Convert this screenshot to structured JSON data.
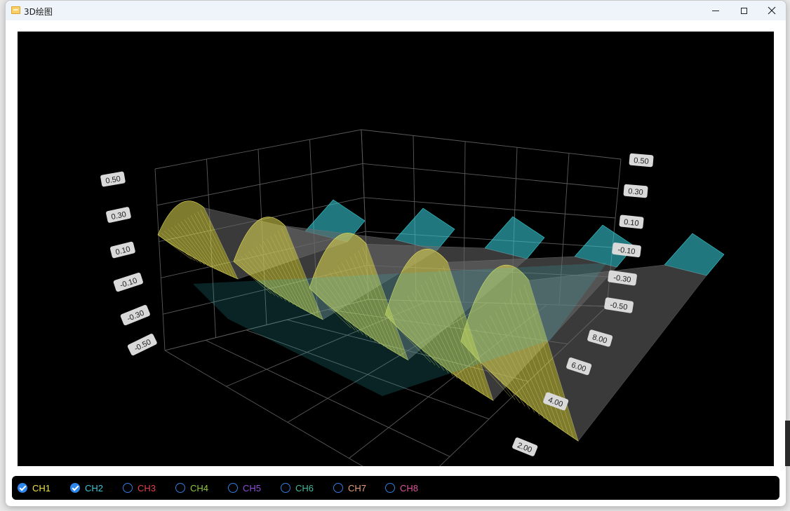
{
  "window": {
    "title": "3D绘图",
    "minimize_icon": "minimize-icon",
    "maximize_icon": "maximize-icon",
    "close_icon": "close-icon"
  },
  "chart_data": {
    "type": "surface-3d",
    "z_ticks": [
      "0.50",
      "0.30",
      "0.10",
      "-0.10",
      "-0.30",
      "-0.50"
    ],
    "depth_ticks": [
      "2.00",
      "4.00",
      "6.00",
      "8.00"
    ],
    "zlim": [
      -0.5,
      0.5
    ],
    "grid": true,
    "background": "#000000",
    "series": [
      {
        "name": "CH1",
        "color": "#e6e055",
        "visible": true
      },
      {
        "name": "CH2",
        "color": "#35c8d2",
        "visible": true
      }
    ]
  },
  "legend": {
    "channels": [
      {
        "label": "CH1",
        "color": "#f0e24a",
        "checked": true
      },
      {
        "label": "CH2",
        "color": "#39c7d8",
        "checked": true
      },
      {
        "label": "CH3",
        "color": "#e2414b",
        "checked": false
      },
      {
        "label": "CH4",
        "color": "#8fc93a",
        "checked": false
      },
      {
        "label": "CH5",
        "color": "#8a4fd6",
        "checked": false
      },
      {
        "label": "CH6",
        "color": "#3fb99d",
        "checked": false
      },
      {
        "label": "CH7",
        "color": "#e8a07a",
        "checked": false
      },
      {
        "label": "CH8",
        "color": "#e0529a",
        "checked": false
      }
    ]
  }
}
